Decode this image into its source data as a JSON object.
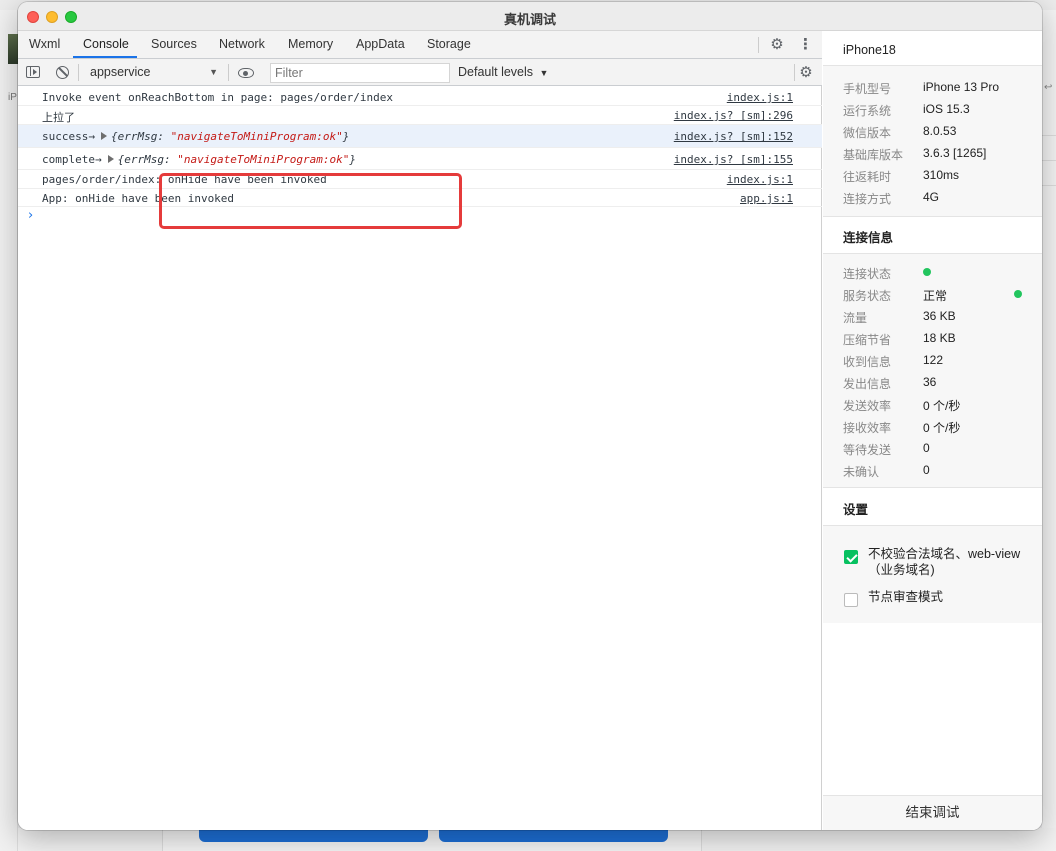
{
  "window": {
    "title": "真机调试"
  },
  "devtools": {
    "tabs": [
      "Wxml",
      "Console",
      "Sources",
      "Network",
      "Memory",
      "AppData",
      "Storage"
    ],
    "active_tab": "Console",
    "toolbar": {
      "context": "appservice",
      "filter_placeholder": "Filter",
      "levels": "Default levels"
    }
  },
  "console": {
    "rows": [
      {
        "message": "Invoke event onReachBottom in page: pages/order/index",
        "source": "index.js:1"
      },
      {
        "message": "上拉了",
        "source": "index.js? [sm]:296"
      },
      {
        "prefix": "success→",
        "obj_open": "{errMsg: ",
        "obj_value": "\"navigateToMiniProgram:ok\"",
        "obj_close": "}",
        "source": "index.js? [sm]:152"
      },
      {
        "prefix": "complete→",
        "obj_open": "{errMsg: ",
        "obj_value": "\"navigateToMiniProgram:ok\"",
        "obj_close": "}",
        "source": "index.js? [sm]:155"
      },
      {
        "message": "pages/order/index: onHide have been invoked",
        "source": "index.js:1"
      },
      {
        "message": "App: onHide have been invoked",
        "source": "app.js:1"
      }
    ],
    "prompt": "›"
  },
  "right_panel": {
    "device_name": "iPhone18",
    "device_info": [
      {
        "key": "手机型号",
        "value": "iPhone 13 Pro"
      },
      {
        "key": "运行系统",
        "value": "iOS 15.3"
      },
      {
        "key": "微信版本",
        "value": "8.0.53"
      },
      {
        "key": "基础库版本",
        "value": "3.6.3 [1265]"
      },
      {
        "key": "往返耗时",
        "value": "310ms"
      },
      {
        "key": "连接方式",
        "value": "4G"
      }
    ],
    "connection_title": "连接信息",
    "connection_info": [
      {
        "key": "连接状态",
        "value": ""
      },
      {
        "key": "服务状态",
        "value": "正常"
      },
      {
        "key": "流量",
        "value": "36 KB"
      },
      {
        "key": "压缩节省",
        "value": "18 KB"
      },
      {
        "key": "收到信息",
        "value": "122"
      },
      {
        "key": "发出信息",
        "value": "36"
      },
      {
        "key": "发送效率",
        "value": "0 个/秒"
      },
      {
        "key": "接收效率",
        "value": "0 个/秒"
      },
      {
        "key": "等待发送",
        "value": "0"
      },
      {
        "key": "未确认",
        "value": "0"
      }
    ],
    "status_color": "#22c55e",
    "settings_title": "设置",
    "settings": [
      {
        "label": "不校验合法域名、web-view（业务域名)",
        "checked": true
      },
      {
        "label": "节点审查模式",
        "checked": false
      }
    ],
    "end_button": "结束调试"
  },
  "background": {
    "left_label": "iP"
  },
  "colors": {
    "accent": "#1a73e8",
    "annotation": "#e53b3b",
    "check": "#07c160"
  }
}
